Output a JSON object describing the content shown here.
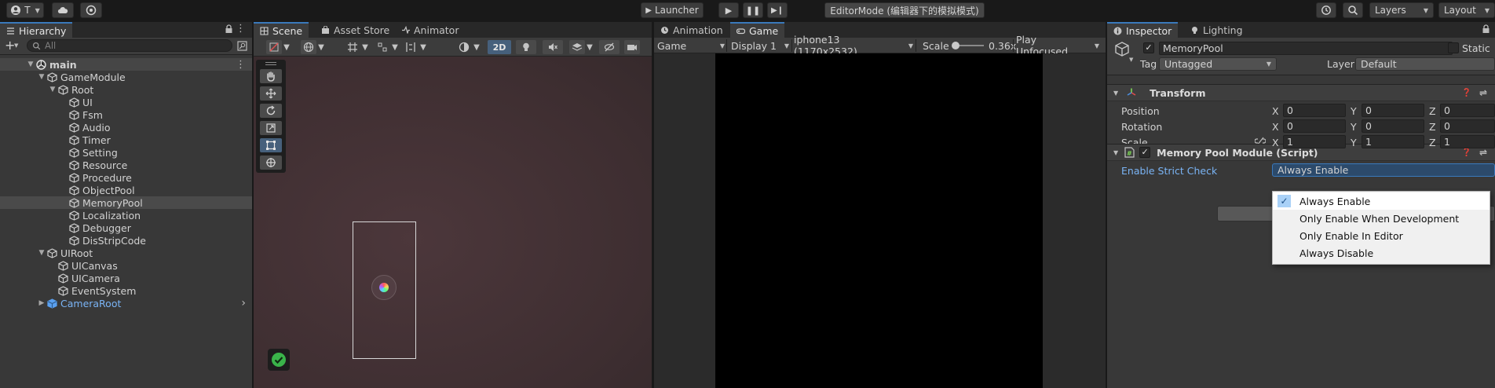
{
  "toolbar": {
    "account_label": "T",
    "launcher_label": "Launcher",
    "editor_mode": "EditorMode (编辑器下的模拟模式)",
    "layers_label": "Layers",
    "layout_label": "Layout"
  },
  "hierarchy": {
    "tab_label": "Hierarchy",
    "search_placeholder": "All",
    "scene_name": "main",
    "items": [
      {
        "label": "GameModule",
        "depth": 1,
        "expanded": true
      },
      {
        "label": "Root",
        "depth": 2,
        "expanded": true
      },
      {
        "label": "UI",
        "depth": 3
      },
      {
        "label": "Fsm",
        "depth": 3
      },
      {
        "label": "Audio",
        "depth": 3
      },
      {
        "label": "Timer",
        "depth": 3
      },
      {
        "label": "Setting",
        "depth": 3
      },
      {
        "label": "Resource",
        "depth": 3
      },
      {
        "label": "Procedure",
        "depth": 3
      },
      {
        "label": "ObjectPool",
        "depth": 3
      },
      {
        "label": "MemoryPool",
        "depth": 3,
        "selected": true
      },
      {
        "label": "Localization",
        "depth": 3
      },
      {
        "label": "Debugger",
        "depth": 3
      },
      {
        "label": "DisStripCode",
        "depth": 3
      },
      {
        "label": "UIRoot",
        "depth": 1,
        "expanded": true
      },
      {
        "label": "UICanvas",
        "depth": 2
      },
      {
        "label": "UICamera",
        "depth": 2
      },
      {
        "label": "EventSystem",
        "depth": 2
      },
      {
        "label": "CameraRoot",
        "depth": 1,
        "collapsed": true,
        "prefab": true
      }
    ]
  },
  "scene": {
    "tabs": [
      "Scene",
      "Asset Store",
      "Animator"
    ],
    "mode_2d": "2D"
  },
  "game": {
    "tabs": [
      "Animation",
      "Game"
    ],
    "mode": "Game",
    "display": "Display 1",
    "resolution": "iphone13 (1170x2532)",
    "scale_label": "Scale",
    "scale_value": "0.36x",
    "play_mode": "Play Unfocused"
  },
  "inspector": {
    "tabs": [
      "Inspector",
      "Lighting"
    ],
    "object_name": "MemoryPool",
    "static_label": "Static",
    "tag_label": "Tag",
    "tag_value": "Untagged",
    "layer_label": "Layer",
    "layer_value": "Default",
    "transform": {
      "title": "Transform",
      "position_label": "Position",
      "rotation_label": "Rotation",
      "scale_label": "Scale",
      "position": [
        "0",
        "0",
        "0"
      ],
      "rotation": [
        "0",
        "0",
        "0"
      ],
      "scale": [
        "1",
        "1",
        "1"
      ],
      "axes": [
        "X",
        "Y",
        "Z"
      ]
    },
    "script": {
      "title": "Memory Pool Module (Script)",
      "strict_label": "Enable Strict Check",
      "strict_value": "Always Enable"
    },
    "dropdown_options": [
      "Always Enable",
      "Only Enable When Development",
      "Only Enable In Editor",
      "Always Disable"
    ],
    "selected_option_index": 0
  },
  "colors": {
    "accent": "#3a79bb",
    "selection": "#4a4a4a",
    "prefab_text": "#7ab4f5",
    "check_bg": "#a9d1f7",
    "scene_bg": "#3e2e31"
  }
}
